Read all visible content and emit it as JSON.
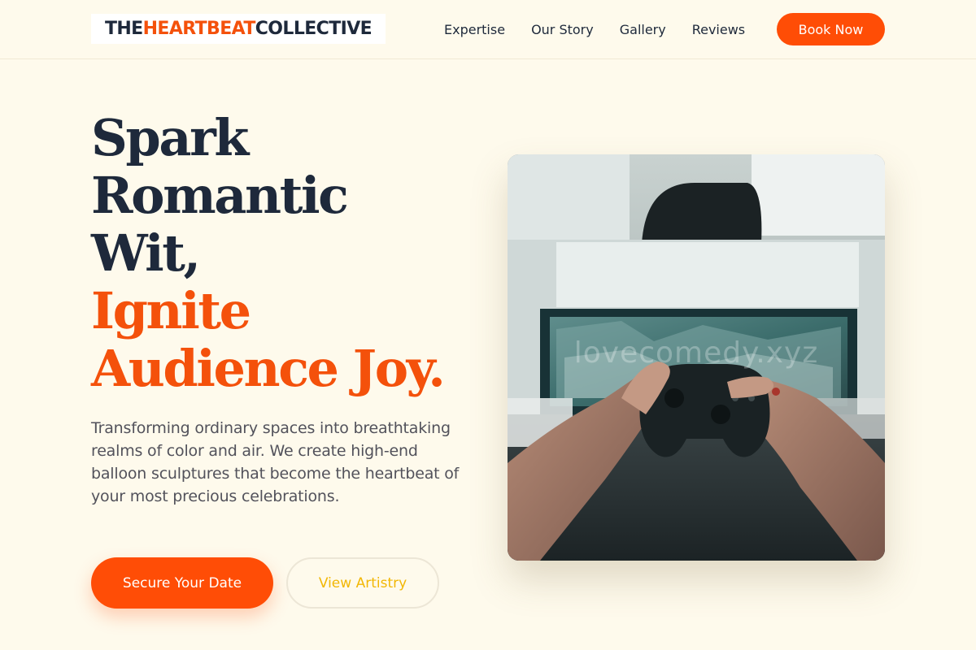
{
  "header": {
    "logo": {
      "part1": "THE ",
      "accent": "HEARTBEAT",
      "part2": " COLLECTIVE"
    },
    "nav": [
      "Expertise",
      "Our Story",
      "Gallery",
      "Reviews"
    ],
    "cta": "Book Now"
  },
  "hero": {
    "headline": {
      "dark": [
        "Spark",
        "Romantic",
        "Wit,"
      ],
      "accent": [
        "Ignite",
        "Audience Joy."
      ]
    },
    "lead": "Transforming ordinary spaces into breathtaking realms of color and air. We create high-end balloon sculptures that become the heartbeat of your most precious celebrations.",
    "primary_button": "Secure Your Date",
    "secondary_button": "View Artistry",
    "image": {
      "subject": "hands holding a game controller in front of a screen",
      "watermark": "lovecomedy.xyz"
    }
  },
  "colors": {
    "background": "#fefaec",
    "accent": "#f4510b",
    "button": "#ff4d06",
    "text": "#1e293b",
    "secondary_text": "#f2b705"
  }
}
